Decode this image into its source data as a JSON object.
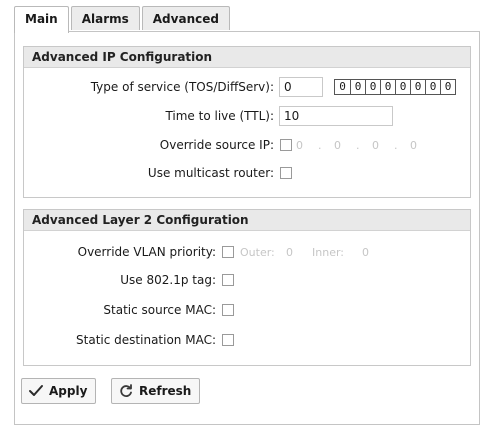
{
  "tabs": [
    {
      "label": "Main",
      "active": true
    },
    {
      "label": "Alarms",
      "active": false
    },
    {
      "label": "Advanced",
      "active": false
    }
  ],
  "ip_section": {
    "title": "Advanced IP Configuration",
    "tos_label": "Type of service (TOS/DiffServ):",
    "tos_value": "0",
    "tos_bits": [
      "0",
      "0",
      "0",
      "0",
      "0",
      "0",
      "0",
      "0"
    ],
    "ttl_label": "Time to live (TTL):",
    "ttl_value": "10",
    "override_ip_label": "Override source IP:",
    "override_ip_octets": [
      "0",
      "0",
      "0",
      "0"
    ],
    "override_ip_checked": false,
    "multicast_label": "Use multicast router:",
    "multicast_checked": false
  },
  "l2_section": {
    "title": "Advanced Layer 2 Configuration",
    "vlan_label": "Override VLAN priority:",
    "vlan_checked": false,
    "outer_label": "Outer:",
    "outer_value": "0",
    "inner_label": "Inner:",
    "inner_value": "0",
    "tag_label": "Use 802.1p tag:",
    "static_src_label": "Static source MAC:",
    "static_dst_label": "Static destination MAC:"
  },
  "buttons": {
    "apply_label": "Apply",
    "refresh_label": "Refresh"
  },
  "colors": {
    "apply_icon": "#2b2b2b",
    "refresh_icon": "#3a3a3a",
    "header_bg": "#e9e9e9"
  }
}
